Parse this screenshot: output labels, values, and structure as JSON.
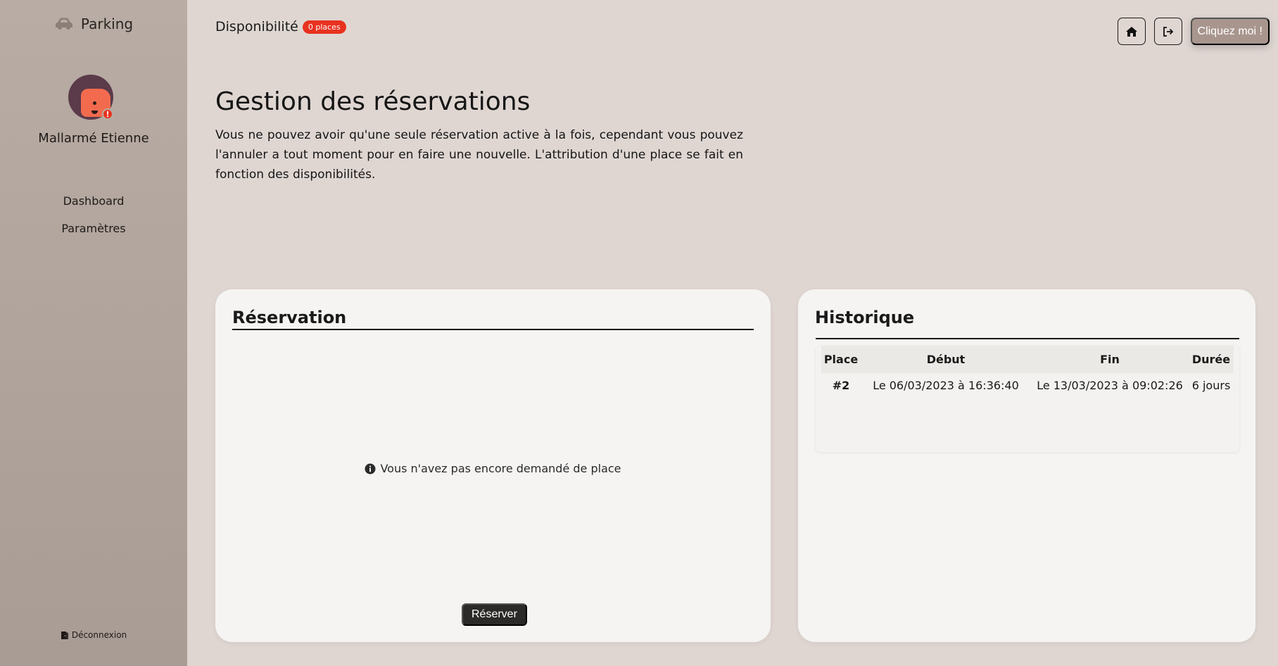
{
  "sidebar": {
    "brand": "Parking",
    "username": "Mallarmé Etienne",
    "alert": "!",
    "nav": [
      {
        "label": "Dashboard"
      },
      {
        "label": "Paramètres"
      }
    ],
    "logout": "Déconnexion"
  },
  "topbar": {
    "title": "Disponibilité",
    "badge": "0 places",
    "cta": "Cliquez moi !"
  },
  "main": {
    "title": "Gestion des réservations",
    "intro": "Vous ne pouvez avoir qu'une seule réservation active à la fois, cependant vous pouvez l'annuler a tout moment pour en faire une nouvelle. L'attribution d'une place se fait en fonction des disponibilités."
  },
  "reservation": {
    "title": "Réservation",
    "empty": "Vous n'avez pas encore demandé de place",
    "button": "Réserver"
  },
  "history": {
    "title": "Historique",
    "columns": [
      "Place",
      "Début",
      "Fin",
      "Durée"
    ],
    "rows": [
      [
        "#2",
        "Le 06/03/2023 à 16:36:40",
        "Le 13/03/2023 à 09:02:26",
        "6 jours"
      ]
    ]
  },
  "colors": {
    "background": "#dfd6d2",
    "sidebar": "#b8aca4",
    "badge": "#e8321f",
    "cta": "#a8968e",
    "card": "#f5f4f2",
    "button": "#2b2a29"
  }
}
